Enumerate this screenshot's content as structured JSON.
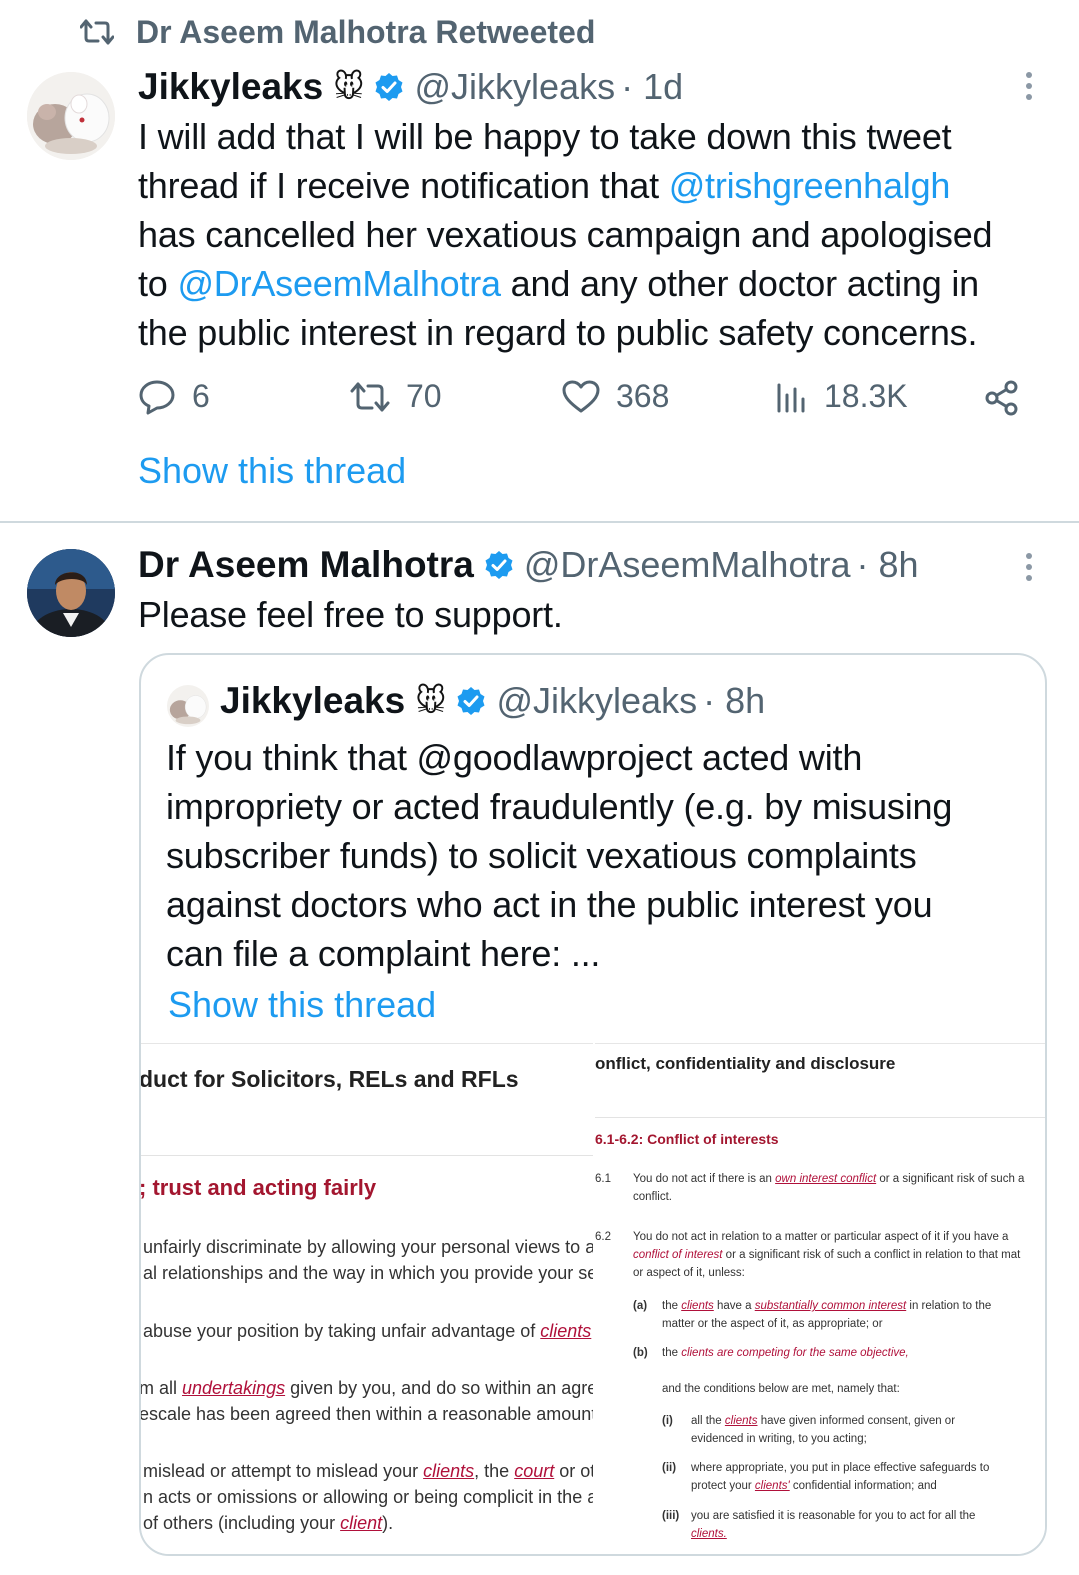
{
  "retweet_header": {
    "text": "Dr Aseem Malhotra Retweeted"
  },
  "tweet1": {
    "name": "Jikkyleaks",
    "emoji": "🐭",
    "handle": "@Jikkyleaks",
    "time": "· 1d",
    "text_parts": [
      "I will add that I will be happy to take down this tweet thread if I receive notification that ",
      "@trishgreenhalgh",
      " has cancelled her vexatious campaign and apologised to ",
      "@DrAseemMalhotra",
      " and any other doctor acting in the public interest in regard to public safety concerns."
    ],
    "lines": [
      [
        "I will add that I will be happy to take down this tweet"
      ],
      [
        "thread if I receive notification that ",
        "@trishgreenhalgh"
      ],
      [
        "has cancelled her vexatious campaign and apologised"
      ],
      [
        "to ",
        "@DrAseemMalhotra",
        " and any other doctor acting in"
      ],
      [
        "the public interest in regard to public safety concerns."
      ]
    ],
    "replies": "6",
    "retweets": "70",
    "likes": "368",
    "views": "18.3K",
    "show_thread": "Show this thread"
  },
  "tweet2": {
    "name": "Dr Aseem Malhotra",
    "handle": "@DrAseemMalhotra",
    "time": "· 8h",
    "text": "Please feel free to support."
  },
  "quote": {
    "name": "Jikkyleaks",
    "emoji": "🐭",
    "handle": "@Jikkyleaks",
    "time": "· 8h",
    "lines": [
      "If you think that @goodlawproject acted with",
      "impropriety or acted fraudulently (e.g. by misusing",
      "subscriber funds) to solicit vexatious complaints",
      "against doctors who act in the public interest you",
      "can file a complaint here: ..."
    ],
    "show_thread": "Show this thread"
  },
  "doc_left": {
    "heading": "duct for Solicitors, RELs and RFLs",
    "subheading": "; trust and acting fairly",
    "paras": [
      {
        "l1": [
          "unfairly discriminate by allowing your personal views to af"
        ],
        "l2": [
          "al relationships and the way in which you provide your serv"
        ]
      },
      {
        "l1": [
          "abuse your position by taking unfair advantage of ",
          {
            "t": "clients"
          },
          " c"
        ]
      },
      {
        "l1": [
          "m all ",
          {
            "t": "undertakings"
          },
          " given by you, and do so within an agree"
        ],
        "l2": [
          "escale has been agreed then within a reasonable amount c"
        ]
      },
      {
        "l1": [
          "mislead or attempt to mislead your ",
          {
            "t": "clients"
          },
          ", the ",
          {
            "t": "court"
          },
          " or ot"
        ],
        "l2": [
          "n acts or omissions or allowing or being complicit in the ac"
        ],
        "l3": [
          "of others (including your ",
          {
            "t": "client"
          },
          ")."
        ]
      }
    ]
  },
  "doc_right": {
    "heading": "onflict, confidentiality and disclosure",
    "subheading": "6.1-6.2: Conflict of interests",
    "n61": "6.1",
    "n62": "6.2",
    "p61_l1_a": "You do not act if there is an ",
    "p61_l1_term": "own interest conflict",
    "p61_l1_b": " or a significant risk of such a",
    "p61_l2": "conflict.",
    "p62_l1": "You do not act in relation to a matter or particular aspect of it if you have a",
    "p62_l2_term": "conflict of interest",
    "p62_l2_b": " or a significant risk of such a conflict in relation to that mat",
    "p62_l3": "or aspect of it, unless:",
    "a_label": "(a)",
    "a_l1_a": "the ",
    "a_l1_term1": "clients",
    "a_l1_b": " have a ",
    "a_l1_term2": "substantially common interest",
    "a_l1_c": " in relation to the",
    "a_l2": "matter or the aspect of it, as appropriate; or",
    "b_label": "(b)",
    "b_l1_a": "the ",
    "b_l1_term": "clients are competing for the same objective,",
    "conditions": "and the conditions below are met, namely that:",
    "i_label": "(i)",
    "i_l1_a": "all the ",
    "i_l1_term": "clients",
    "i_l1_b": " have given informed consent, given or",
    "i_l2": "evidenced in writing, to you acting;",
    "ii_label": "(ii)",
    "ii_l1": "where appropriate, you put in place effective safeguards to",
    "ii_l2_a": "protect your ",
    "ii_l2_term": "clients'",
    "ii_l2_b": " confidential information; and",
    "iii_label": "(iii)",
    "iii_l1": "you are satisfied it is reasonable for you to act for all the",
    "iii_l2_term": "clients."
  },
  "colors": {
    "accent": "#1d9bf0",
    "secondary": "#536471",
    "term": "#b0103a"
  }
}
